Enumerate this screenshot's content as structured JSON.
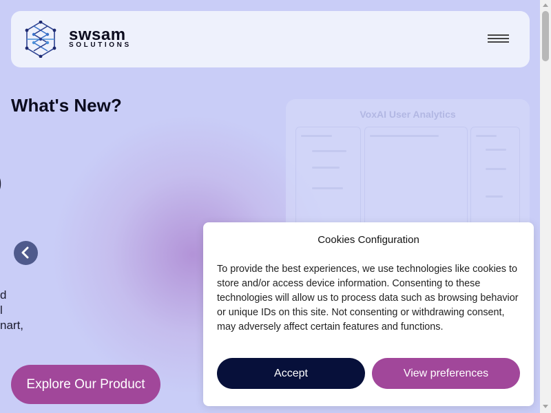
{
  "header": {
    "logo_name": "swsam",
    "logo_sub": "SOLUTIONS",
    "menu_icon": "hamburger-icon"
  },
  "hero": {
    "title": "What's New?",
    "partial_glyph": ")",
    "partial_lines": [
      "d",
      "l",
      "nart,"
    ],
    "prev_icon": "chevron-left-icon",
    "cta_label": "Explore Our Product"
  },
  "preview": {
    "title": "VoxAI User Analytics"
  },
  "cookie": {
    "title": "Cookies Configuration",
    "body": "To provide the best experiences, we use technologies like cookies to store and/or access device information. Consenting to these technologies will allow us to process data such as browsing behavior or unique IDs on this site. Not consenting or withdrawing consent, may adversely affect certain features and functions.",
    "accept_label": "Accept",
    "prefs_label": "View preferences"
  },
  "colors": {
    "page_bg": "#c9cdf7",
    "brand_purple": "#a1479a",
    "navy": "#07103a",
    "header_bg": "#eef1fc"
  }
}
